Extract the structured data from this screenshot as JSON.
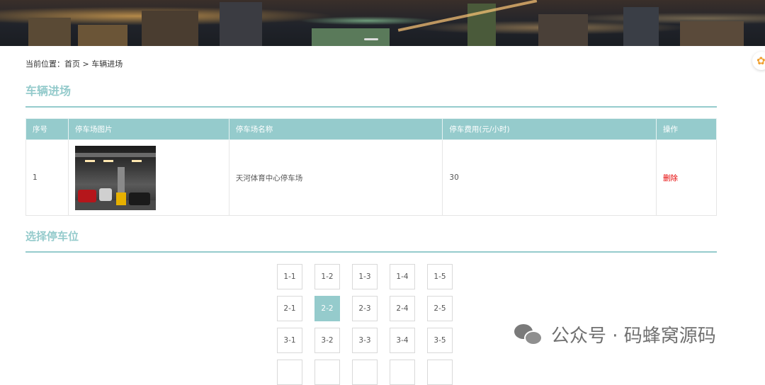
{
  "breadcrumb": {
    "label": "当前位置：",
    "home": "首页",
    "separator": " > ",
    "current": "车辆进场"
  },
  "section1_title": "车辆进场",
  "table": {
    "headers": [
      "序号",
      "停车场图片",
      "停车场名称",
      "停车费用(元/小时)",
      "操作"
    ],
    "rows": [
      {
        "index": "1",
        "name": "天河体育中心停车场",
        "fee": "30",
        "action": "删除"
      }
    ]
  },
  "section2_title": "选择停车位",
  "spots": [
    [
      "1-1",
      "1-2",
      "1-3",
      "1-4",
      "1-5"
    ],
    [
      "2-1",
      "2-2",
      "2-3",
      "2-4",
      "2-5"
    ],
    [
      "3-1",
      "3-2",
      "3-3",
      "3-4",
      "3-5"
    ],
    [
      "",
      "",
      "",
      "",
      ""
    ]
  ],
  "selected_spot": "2-2",
  "watermark": "公众号 · 码蜂窝源码",
  "colors": {
    "accent": "#95cbcc",
    "danger": "#e60000"
  },
  "icons": [
    "flower-icon",
    "wechat-icon"
  ]
}
